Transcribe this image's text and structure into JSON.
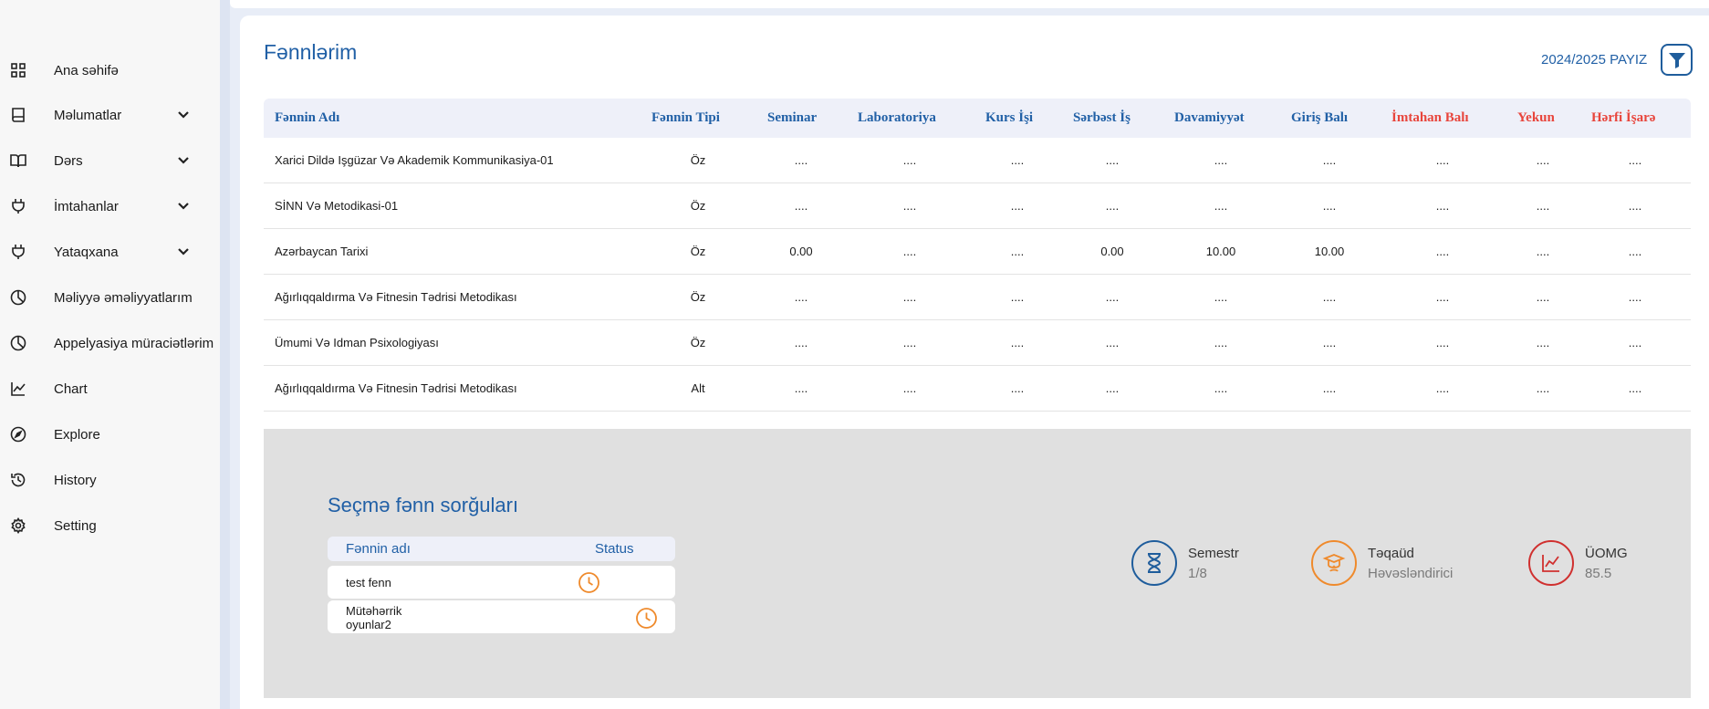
{
  "sidebar": {
    "items": [
      {
        "label": "Ana səhifə",
        "icon": "grid-icon",
        "has_chevron": false
      },
      {
        "label": "Məlumatlar",
        "icon": "book-icon",
        "has_chevron": true
      },
      {
        "label": "Dərs",
        "icon": "open-book-icon",
        "has_chevron": true
      },
      {
        "label": "İmtahanlar",
        "icon": "plug-icon",
        "has_chevron": true
      },
      {
        "label": "Yataqxana",
        "icon": "plug-icon",
        "has_chevron": true
      },
      {
        "label": "Məliyyə əməliyyatlarım",
        "icon": "pie-chart-icon",
        "has_chevron": false
      },
      {
        "label": "Appelyasiya müraciətlərim",
        "icon": "pie-chart-icon",
        "has_chevron": false
      },
      {
        "label": "Chart",
        "icon": "line-chart-icon",
        "has_chevron": false
      },
      {
        "label": "Explore",
        "icon": "compass-icon",
        "has_chevron": false
      },
      {
        "label": "History",
        "icon": "history-icon",
        "has_chevron": false
      },
      {
        "label": "Setting",
        "icon": "gear-icon",
        "has_chevron": false
      }
    ]
  },
  "header": {
    "title": "Fənnlərim",
    "semester": "2024/2025 PAYIZ",
    "filter_icon": "funnel-icon"
  },
  "table": {
    "columns": [
      {
        "label": "Fənnin Adı",
        "color": "#2160a6"
      },
      {
        "label": "Fənnin Tipi",
        "color": "#2160a6"
      },
      {
        "label": "Seminar",
        "color": "#2160a6"
      },
      {
        "label": "Laboratoriya",
        "color": "#2160a6"
      },
      {
        "label": "Kurs İşi",
        "color": "#2160a6"
      },
      {
        "label": "Sərbəst İş",
        "color": "#2160a6"
      },
      {
        "label": "Davamiyyət",
        "color": "#2160a6"
      },
      {
        "label": "Giriş Balı",
        "color": "#2160a6"
      },
      {
        "label": "İmtahan Balı",
        "color": "#e8453c"
      },
      {
        "label": "Yekun",
        "color": "#e8453c"
      },
      {
        "label": "Hərfi İşarə",
        "color": "#e8453c"
      }
    ],
    "rows": [
      [
        "Xarici Dildə Işgüzar Və Akademik Kommunikasiya-01",
        "Öz",
        "....",
        "....",
        "....",
        "....",
        "....",
        "....",
        "....",
        "....",
        "...."
      ],
      [
        "SİNN Və Metodikasi-01",
        "Öz",
        "....",
        "....",
        "....",
        "....",
        "....",
        "....",
        "....",
        "....",
        "...."
      ],
      [
        "Azərbaycan Tarixi",
        "Öz",
        "0.00",
        "....",
        "....",
        "0.00",
        "10.00",
        "10.00",
        "....",
        "....",
        "...."
      ],
      [
        "Ağırlıqqaldırma Və Fitnesin Tədrisi Metodikası",
        "Öz",
        "....",
        "....",
        "....",
        "....",
        "....",
        "....",
        "....",
        "....",
        "...."
      ],
      [
        "Ümumi Və Idman Psixologiyası",
        "Öz",
        "....",
        "....",
        "....",
        "....",
        "....",
        "....",
        "....",
        "....",
        "...."
      ],
      [
        "Ağırlıqqaldırma Və Fitnesin Tədrisi Metodikası",
        "Alt",
        "....",
        "....",
        "....",
        "....",
        "....",
        "....",
        "....",
        "....",
        "...."
      ]
    ]
  },
  "requests": {
    "title": "Seçmə fənn sorğuları",
    "col_name": "Fənnin adı",
    "col_status": "Status",
    "items": [
      {
        "name": "test fenn",
        "status_icon": "clock-icon"
      },
      {
        "name": "Mütəhərrik oyunlar2",
        "status_icon": "clock-icon"
      }
    ]
  },
  "stats": [
    {
      "title": "Semestr",
      "value": "1/8",
      "icon": "hourglass-icon",
      "color": "#1f5d9c"
    },
    {
      "title": "Təqaüd",
      "value": "Həvəsləndirici",
      "icon": "graduate-icon",
      "color": "#ef8a2c"
    },
    {
      "title": "ÜOMG",
      "value": "85.5",
      "icon": "chart-line-icon",
      "color": "#d0302f"
    }
  ]
}
